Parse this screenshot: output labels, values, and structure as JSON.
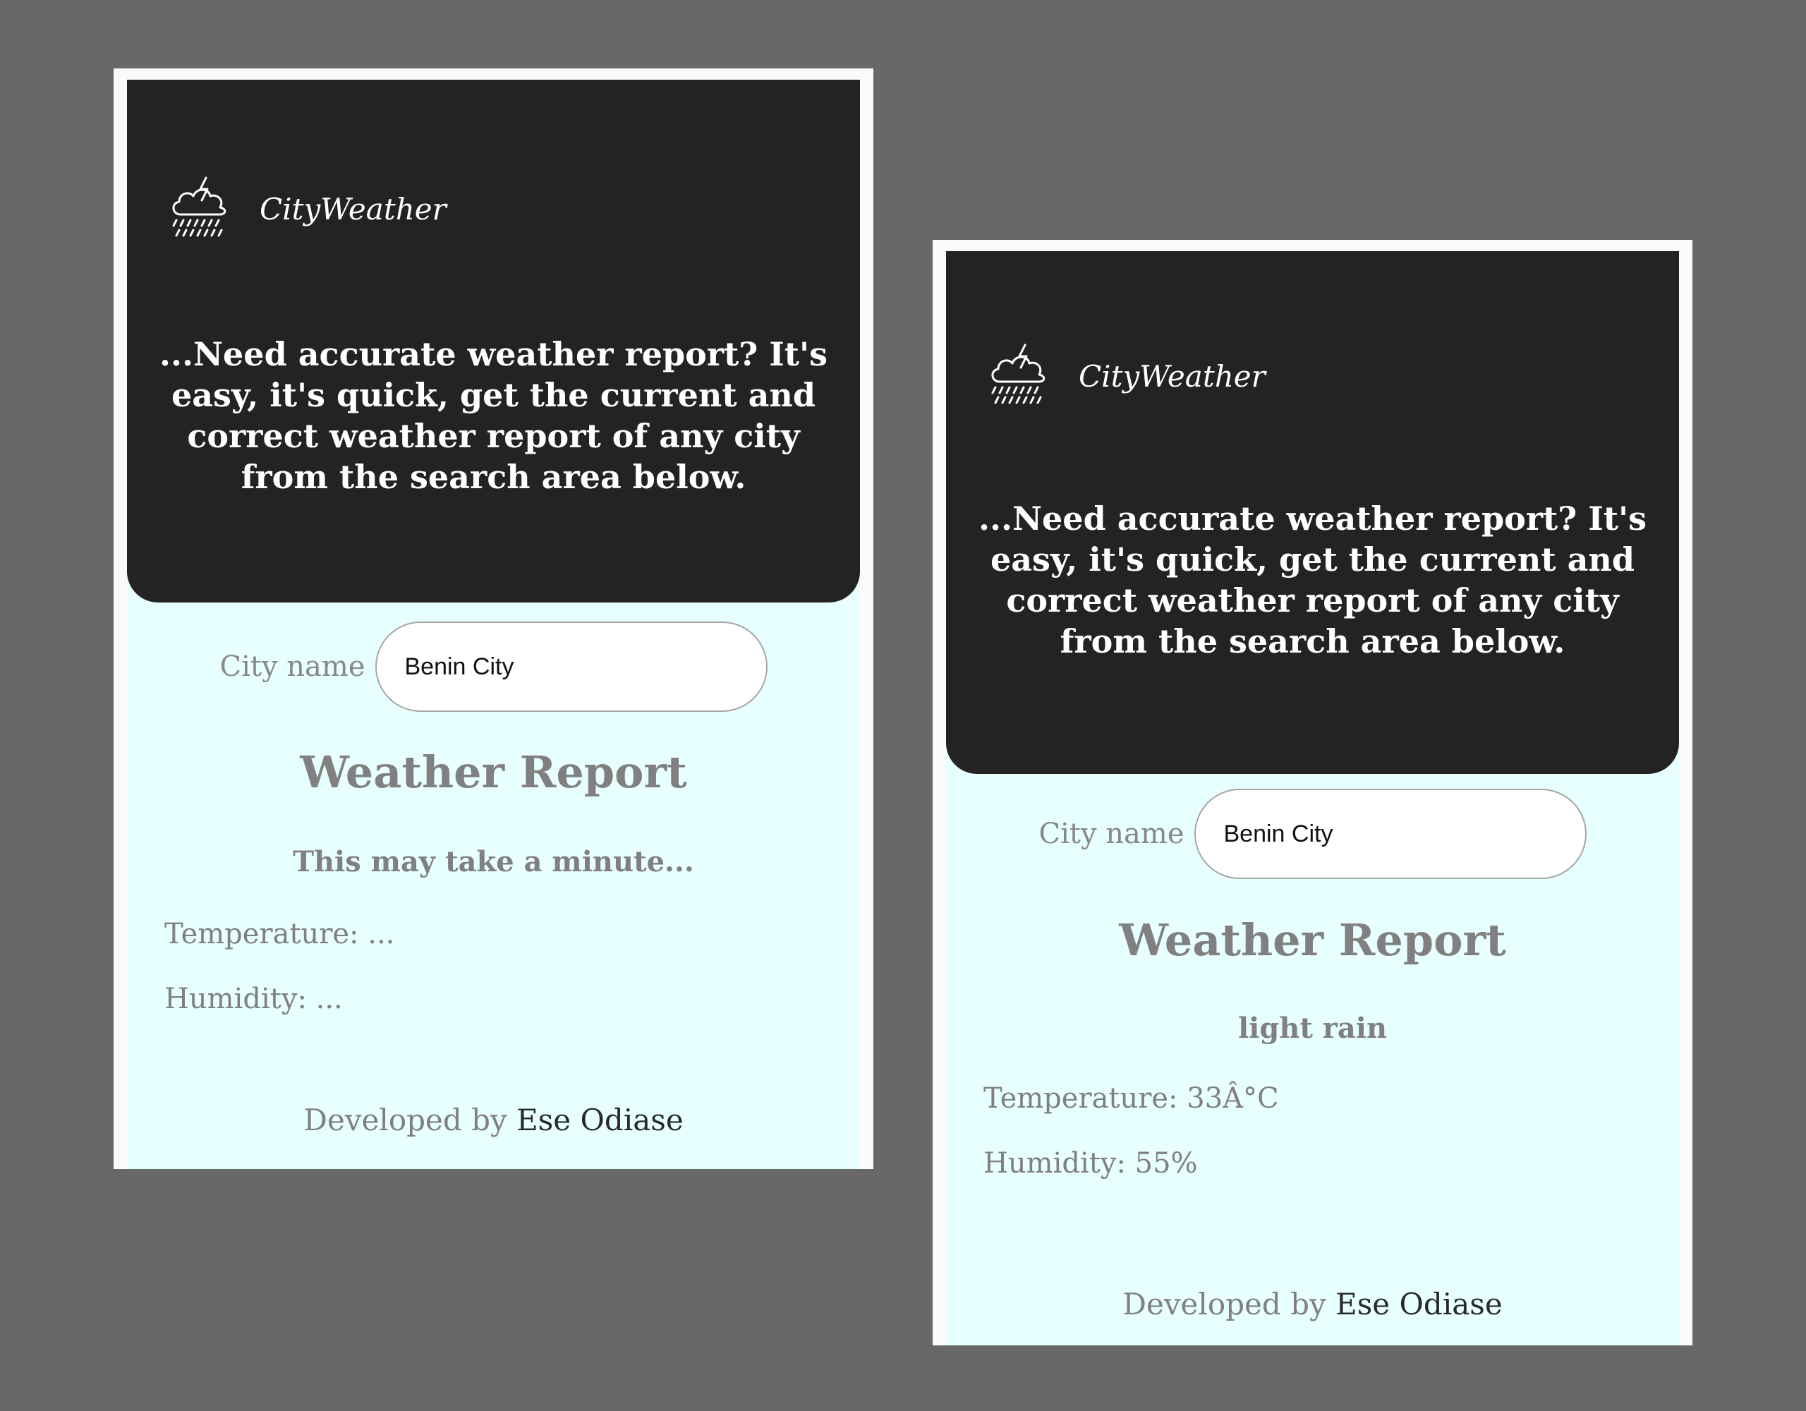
{
  "colors": {
    "page_background": "#686868",
    "hero_background": "#232323",
    "content_background": "#e7fffe",
    "muted_text": "#808080"
  },
  "screens": [
    {
      "brand": {
        "icon": "storm-cloud-icon",
        "name": "CityWeather"
      },
      "tagline": "...Need accurate weather report? It's easy, it's quick, get the current and correct weather report of any city from the search area below.",
      "search": {
        "label": "City name",
        "value": "Benin City"
      },
      "report": {
        "title": "Weather Report",
        "description": "This may take a minute...",
        "temperature": "Temperature: ...",
        "humidity": "Humidity: ..."
      },
      "footer": {
        "prefix": "Developed by",
        "author": "Ese Odiase"
      }
    },
    {
      "brand": {
        "icon": "storm-cloud-icon",
        "name": "CityWeather"
      },
      "tagline": "...Need accurate weather report? It's easy, it's quick, get the current and correct weather report of any city from the search area below.",
      "search": {
        "label": "City name",
        "value": "Benin City"
      },
      "report": {
        "title": "Weather Report",
        "description": "light rain",
        "temperature": "Temperature: 33Â°C",
        "humidity": "Humidity: 55%"
      },
      "footer": {
        "prefix": "Developed by",
        "author": "Ese Odiase"
      }
    }
  ]
}
